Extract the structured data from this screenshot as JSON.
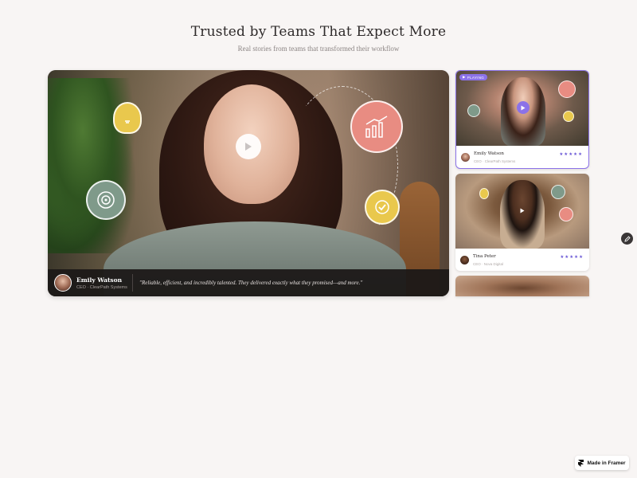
{
  "header": {
    "title": "Trusted by Teams That Expect More",
    "subtitle": "Real stories from teams that transformed their workflow"
  },
  "featured": {
    "name": "Emily Watson",
    "role": "CEO · ClearPath Systems",
    "quote": "\"Reliable, efficient, and incredibly talented. They delivered exactly what they promised—and more.\""
  },
  "cards": [
    {
      "tag": "PLAYING",
      "name": "Emily Watson",
      "role": "CEO · ClearPath Systems",
      "stars": "★★★★★",
      "selected": true
    },
    {
      "name": "Tina Peter",
      "role": "CEO · Nova Digital",
      "stars": "★★★★★",
      "selected": false
    }
  ],
  "badge": {
    "label": "Made in Framer"
  },
  "colors": {
    "accent": "#8b72e8",
    "background": "#f8f5f4",
    "star": "#6a58d6"
  }
}
